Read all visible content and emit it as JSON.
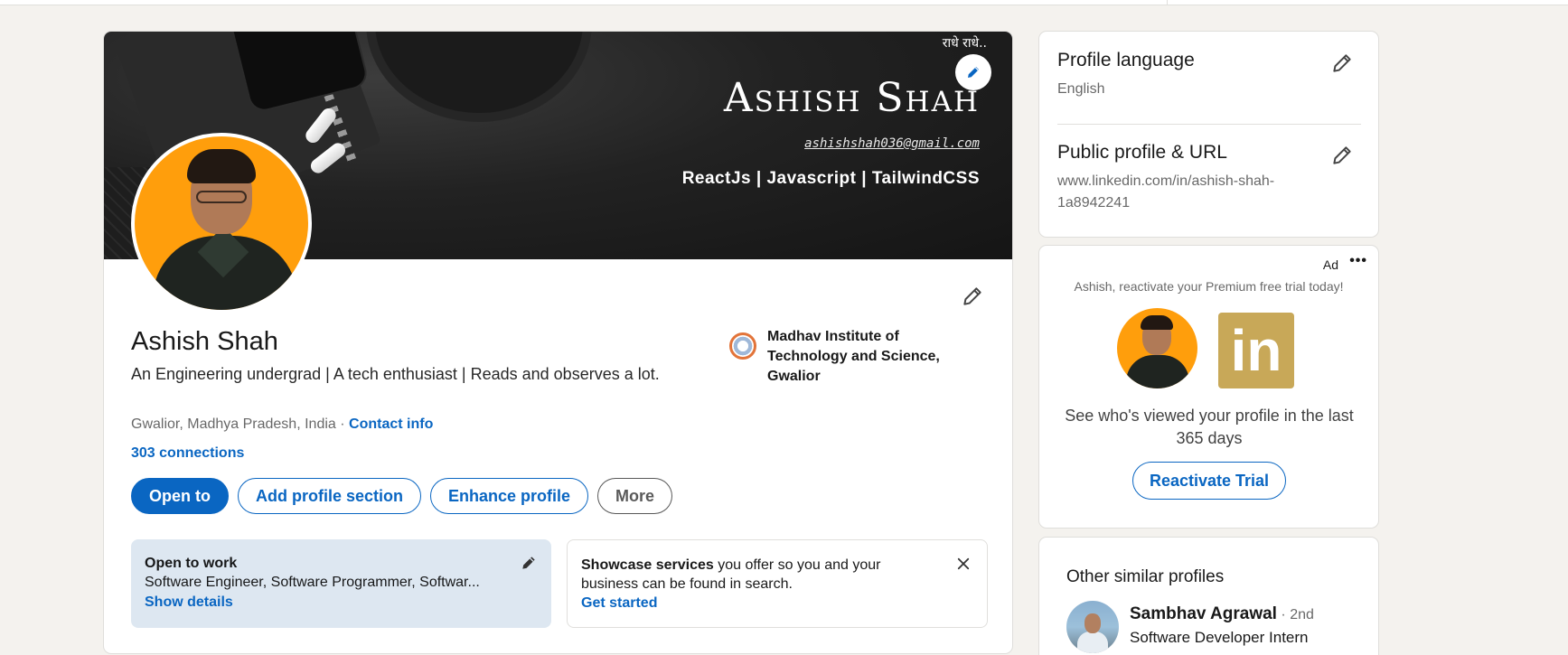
{
  "banner": {
    "hindi_text": "राधे राधे..",
    "name": "Ashish Shah",
    "email": "ashishshah036@gmail.com",
    "tags": "ReactJs | Javascript | TailwindCSS"
  },
  "profile": {
    "name": "Ashish Shah",
    "headline": "An Engineering undergrad | A tech enthusiast | Reads and observes a lot.",
    "location": "Gwalior, Madhya Pradesh, India ·",
    "contact_info": "Contact info",
    "connections": "303 connections",
    "education": "Madhav Institute of Technology and Science, Gwalior"
  },
  "actions": {
    "open_to": "Open to",
    "add_section": "Add profile section",
    "enhance": "Enhance profile",
    "more": "More"
  },
  "open_to_work": {
    "title": "Open to work",
    "roles": "Software Engineer, Software Programmer, Softwar...",
    "link": "Show details"
  },
  "showcase": {
    "bold": "Showcase services",
    "rest": " you offer so you and your business can be found in search.",
    "link": "Get started"
  },
  "sidebar": {
    "language_title": "Profile language",
    "language_value": "English",
    "url_title": "Public profile & URL",
    "url_value": "www.linkedin.com/in/ashish-shah-1a8942241"
  },
  "ad": {
    "label": "Ad",
    "more": "•••",
    "text": "Ashish, reactivate your Premium free trial today!",
    "logo": "in",
    "headline": "See who's viewed your profile in the last 365 days",
    "button": "Reactivate Trial"
  },
  "similar": {
    "title": "Other similar profiles",
    "name": "Sambhav Agrawal",
    "degree": " · 2nd",
    "role": "Software Developer Intern"
  },
  "colors": {
    "accent": "#0a66c2",
    "page_bg": "#f4f2ee",
    "open_to_work_bg": "#dde7f1",
    "avatar_bg": "#ff9e0c",
    "premium_gold": "#c8a858"
  }
}
